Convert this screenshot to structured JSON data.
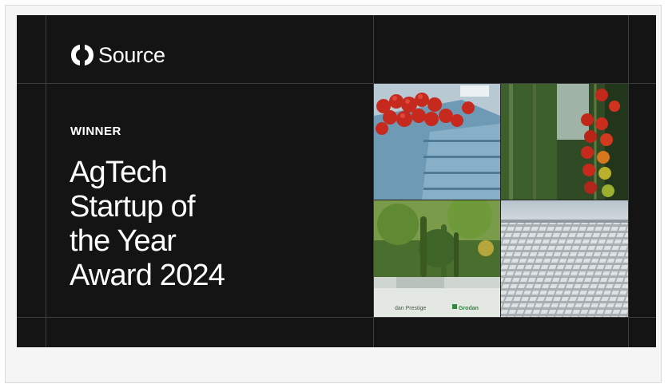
{
  "brand": {
    "name": "Source",
    "icon": "source-logo-icon"
  },
  "award": {
    "eyebrow": "WINNER",
    "title_lines": [
      "AgTech",
      "Startup of",
      "the Year",
      "Award 2024"
    ]
  },
  "photos": [
    {
      "name": "photo-tomato-crates",
      "caption": ""
    },
    {
      "name": "photo-tomato-vine",
      "caption": ""
    },
    {
      "name": "photo-cucumber-plants",
      "labels": [
        "dan Prestige",
        "Grodan"
      ]
    },
    {
      "name": "photo-greenhouse-roof",
      "caption": ""
    }
  ],
  "colors": {
    "background": "#141414",
    "text": "#ffffff",
    "grid_line": "#3d3d3d"
  }
}
